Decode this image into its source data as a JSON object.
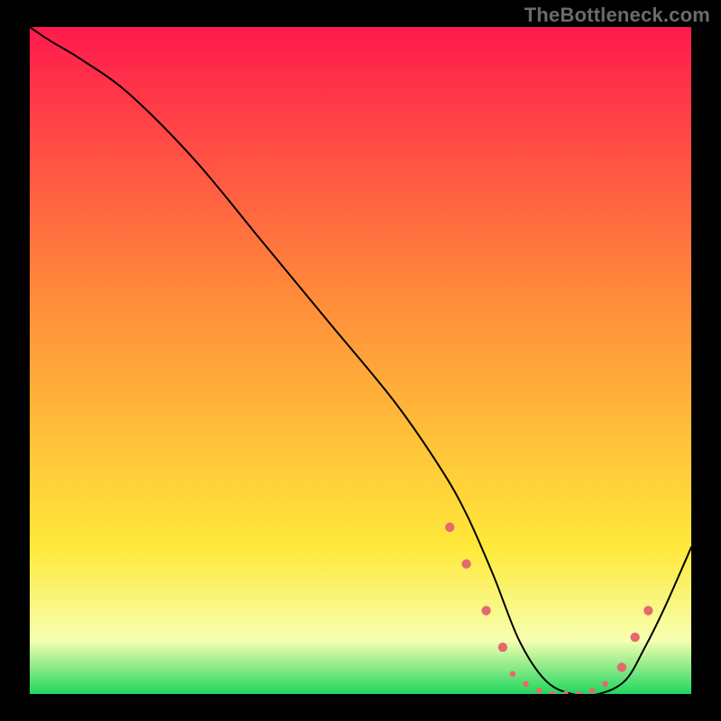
{
  "attribution": "TheBottleneck.com",
  "chart_data": {
    "type": "line",
    "title": "",
    "xlabel": "",
    "ylabel": "",
    "xlim": [
      0,
      100
    ],
    "ylim": [
      0,
      100
    ],
    "grid": false,
    "legend": false,
    "background_gradient": {
      "top": "#ff1a4d",
      "mid1": "#ff8a3a",
      "mid2": "#ffe93a",
      "bottom": "#1fd65f"
    },
    "series": [
      {
        "name": "curve",
        "color": "#000000",
        "stroke_width": 2,
        "x": [
          0,
          3,
          8,
          15,
          25,
          35,
          45,
          55,
          62,
          66,
          70,
          74,
          78,
          82,
          86,
          90,
          93,
          96,
          100
        ],
        "values": [
          100,
          98,
          95,
          90,
          80,
          68,
          56,
          44,
          34,
          27,
          18,
          8,
          2,
          0,
          0,
          2,
          7,
          13,
          22
        ]
      }
    ],
    "markers": {
      "color": "#e46a6f",
      "radius_small": 3.3,
      "radius_large": 5.2,
      "points": [
        {
          "x": 63.5,
          "y": 25.0,
          "r": "large"
        },
        {
          "x": 66.0,
          "y": 19.5,
          "r": "large"
        },
        {
          "x": 69.0,
          "y": 12.5,
          "r": "large"
        },
        {
          "x": 71.5,
          "y": 7.0,
          "r": "large"
        },
        {
          "x": 73.0,
          "y": 3.0,
          "r": "small"
        },
        {
          "x": 75.0,
          "y": 1.5,
          "r": "small"
        },
        {
          "x": 77.0,
          "y": 0.5,
          "r": "small"
        },
        {
          "x": 79.0,
          "y": 0.0,
          "r": "small"
        },
        {
          "x": 81.0,
          "y": 0.0,
          "r": "small"
        },
        {
          "x": 83.0,
          "y": 0.0,
          "r": "small"
        },
        {
          "x": 85.0,
          "y": 0.5,
          "r": "small"
        },
        {
          "x": 87.0,
          "y": 1.5,
          "r": "small"
        },
        {
          "x": 89.5,
          "y": 4.0,
          "r": "large"
        },
        {
          "x": 91.5,
          "y": 8.5,
          "r": "large"
        },
        {
          "x": 93.5,
          "y": 12.5,
          "r": "large"
        }
      ]
    }
  }
}
